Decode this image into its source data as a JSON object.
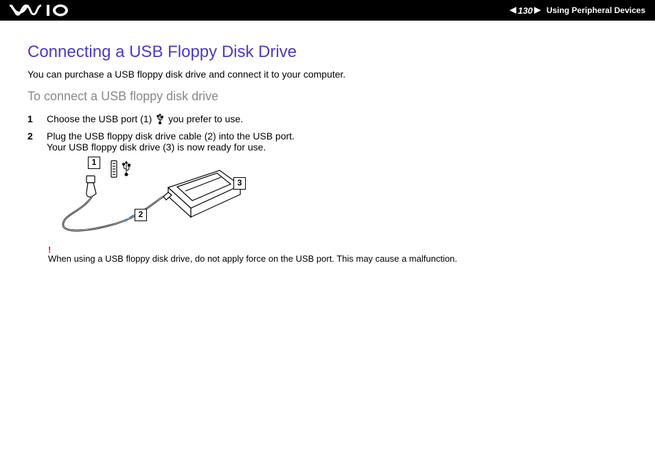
{
  "header": {
    "page_number": "130",
    "section": "Using Peripheral Devices"
  },
  "title": "Connecting a USB Floppy Disk Drive",
  "intro": "You can purchase a USB floppy disk drive and connect it to your computer.",
  "subtitle": "To connect a USB floppy disk drive",
  "steps": [
    {
      "n": "1",
      "before": "Choose the USB port (1) ",
      "after": " you prefer to use."
    },
    {
      "n": "2",
      "before": "Plug the USB floppy disk drive cable (2) into the USB port.",
      "after": "",
      "line2": "Your USB floppy disk drive (3) is now ready for use."
    }
  ],
  "callouts": {
    "c1": "1",
    "c2": "2",
    "c3": "3"
  },
  "warning": {
    "mark": "!",
    "text": "When using a USB floppy disk drive, do not apply force on the USB port. This may cause a malfunction."
  }
}
